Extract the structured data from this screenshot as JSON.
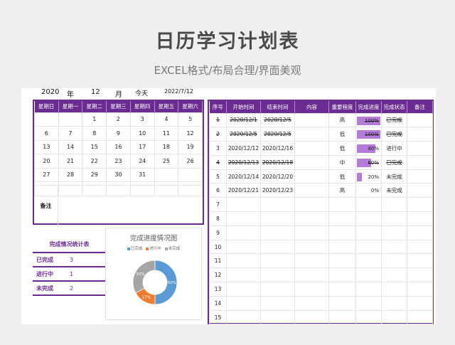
{
  "header": {
    "title": "日历学习计划表",
    "subtitle": "EXCEL格式/布局合理/界面美观"
  },
  "date_bar": {
    "year": "2020",
    "year_lbl": "年",
    "month": "12",
    "month_lbl": "月",
    "today_lbl": "今天",
    "today": "2022/7/12"
  },
  "calendar": {
    "weekdays": [
      "星期日",
      "星期一",
      "星期二",
      "星期三",
      "星期四",
      "星期五",
      "星期六"
    ],
    "weeks": [
      [
        "",
        "",
        "1",
        "2",
        "3",
        "4",
        "5"
      ],
      [
        "6",
        "7",
        "8",
        "9",
        "10",
        "11",
        "12"
      ],
      [
        "13",
        "14",
        "15",
        "16",
        "17",
        "18",
        "19"
      ],
      [
        "20",
        "21",
        "22",
        "23",
        "24",
        "25",
        "26"
      ],
      [
        "27",
        "28",
        "29",
        "30",
        "31",
        "",
        ""
      ],
      [
        "",
        "",
        "",
        "",
        "",
        "",
        ""
      ]
    ],
    "note_label": "备注"
  },
  "stats": {
    "title": "完成情况统计表",
    "rows": [
      {
        "label": "已完成",
        "value": "3"
      },
      {
        "label": "进行中",
        "value": "1"
      },
      {
        "label": "未完成",
        "value": "2"
      }
    ]
  },
  "chart_data": {
    "type": "pie",
    "title": "完成进度情况图",
    "categories": [
      "已完成",
      "进行中",
      "未完成"
    ],
    "values": [
      50,
      17,
      33
    ],
    "labels": [
      "50%",
      "17%",
      "33%"
    ],
    "colors": [
      "#5b9bd5",
      "#ed7d31",
      "#a5a5a5"
    ],
    "legend": "top"
  },
  "tasks": {
    "columns": [
      "序号",
      "开始时间",
      "结束时间",
      "内容",
      "重要程度",
      "完成进度",
      "完成状态",
      "备注"
    ],
    "rows": [
      {
        "no": "1",
        "start": "2020/12/1",
        "end": "2020/12/5",
        "content": "",
        "priority": "高",
        "progress": 100,
        "progress_label": "100%",
        "status": "已完成",
        "note": "",
        "done": true
      },
      {
        "no": "2",
        "start": "2020/12/5",
        "end": "2020/12/5",
        "content": "",
        "priority": "低",
        "progress": 100,
        "progress_label": "100%",
        "status": "已完成",
        "note": "",
        "done": true
      },
      {
        "no": "3",
        "start": "2020/12/12",
        "end": "2020/12/16",
        "content": "",
        "priority": "低",
        "progress": 80,
        "progress_label": "80%",
        "status": "进行中",
        "note": "",
        "done": false
      },
      {
        "no": "4",
        "start": "2020/12/13",
        "end": "2020/12/18",
        "content": "",
        "priority": "中",
        "progress": 60,
        "progress_label": "60%",
        "status": "已完成",
        "note": "",
        "done": true
      },
      {
        "no": "5",
        "start": "2020/12/14",
        "end": "2020/12/20",
        "content": "",
        "priority": "低",
        "progress": 20,
        "progress_label": "20%",
        "status": "未完成",
        "note": "",
        "done": false
      },
      {
        "no": "6",
        "start": "2020/12/21",
        "end": "2020/12/23",
        "content": "",
        "priority": "高",
        "progress": 0,
        "progress_label": "0%",
        "status": "未完成",
        "note": "",
        "done": false
      },
      {
        "no": "7"
      },
      {
        "no": "8"
      },
      {
        "no": "9"
      },
      {
        "no": "10"
      },
      {
        "no": "11"
      },
      {
        "no": "12"
      },
      {
        "no": "13"
      },
      {
        "no": "14"
      },
      {
        "no": "15"
      }
    ]
  }
}
